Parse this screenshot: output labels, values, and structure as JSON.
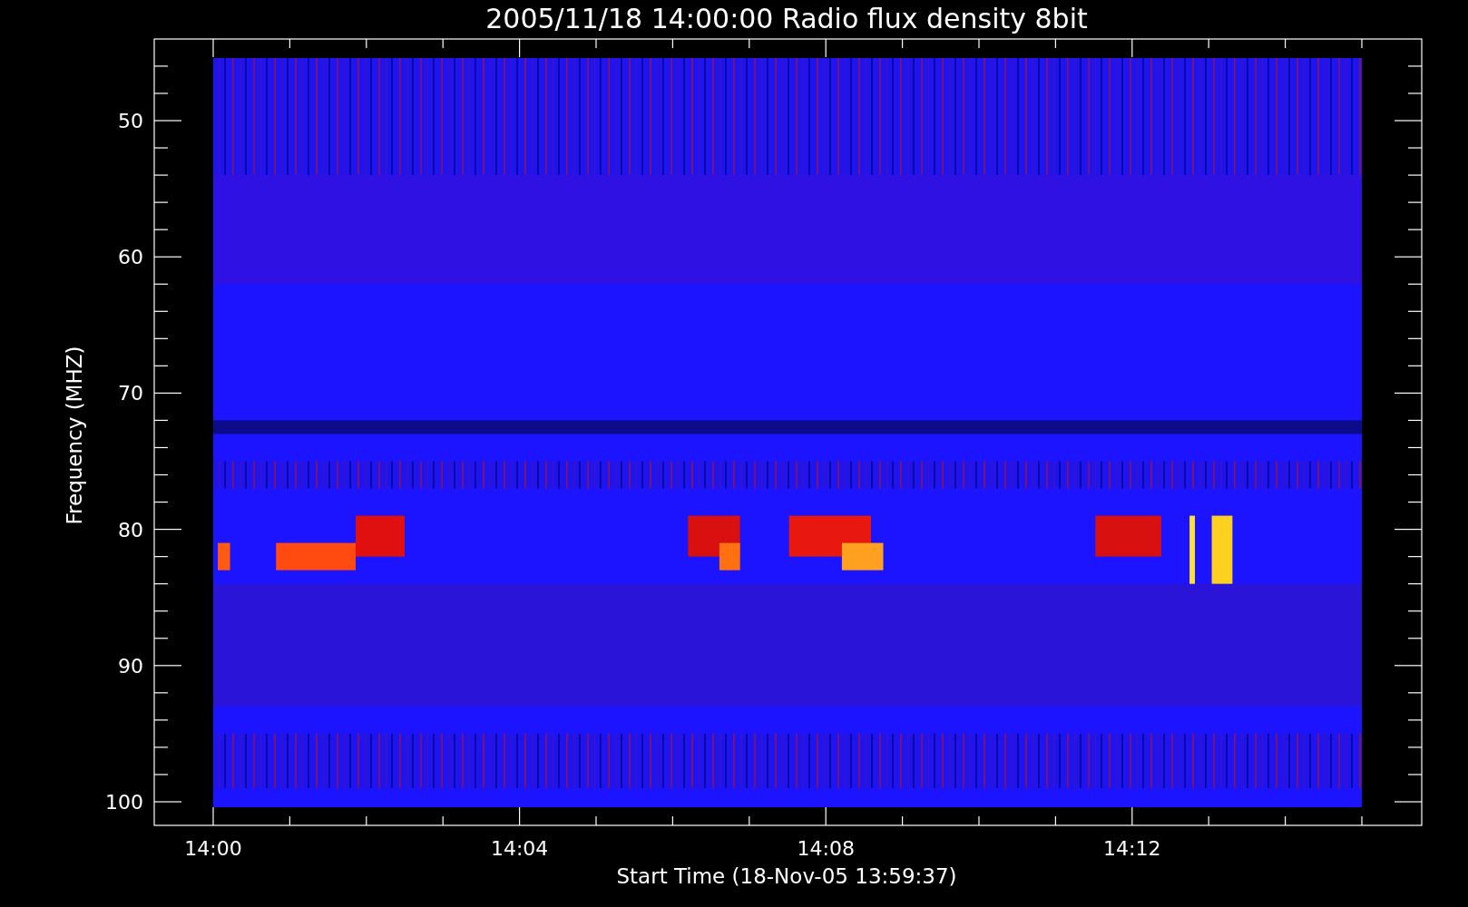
{
  "plot": {
    "title": "2005/11/18 14:00:00 Radio flux density 8bit",
    "y_axis": {
      "label": "Frequency (MHZ)",
      "ticks": [
        "50",
        "60",
        "70",
        "80",
        "90",
        "100"
      ]
    },
    "x_axis": {
      "label": "Start Time (18-Nov-05 13:59:37)",
      "ticks": [
        "14:00",
        "14:04",
        "14:08",
        "14:12"
      ]
    }
  }
}
